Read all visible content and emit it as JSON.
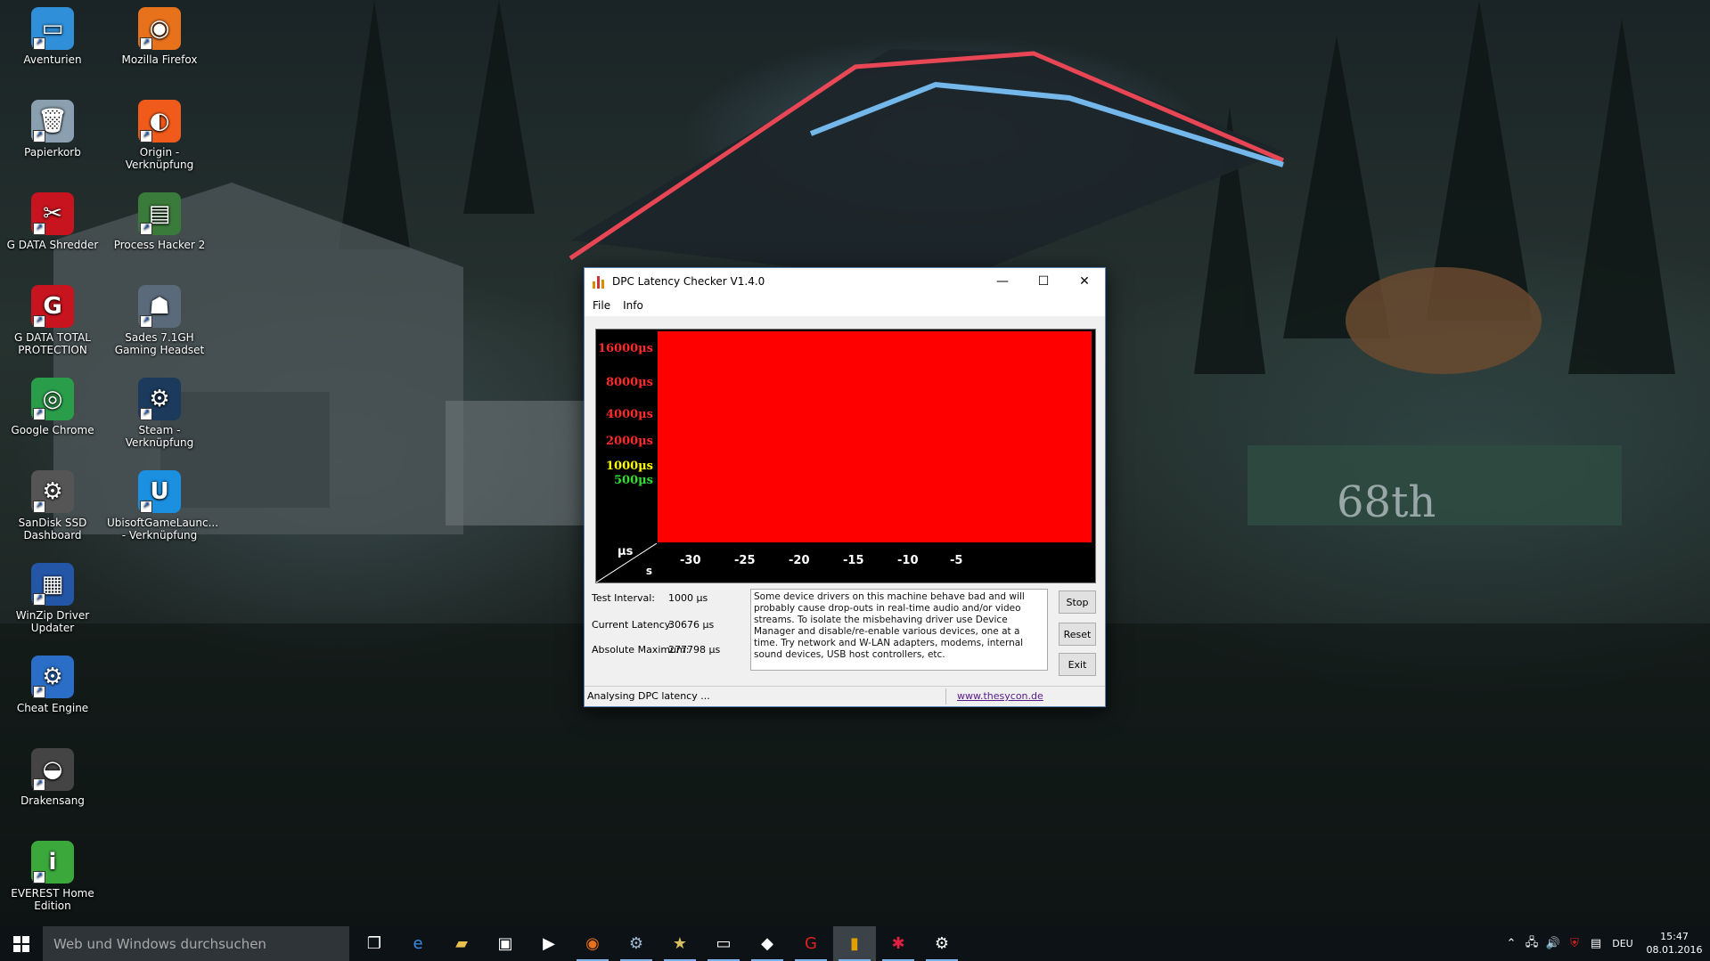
{
  "desktop": {
    "icons": [
      {
        "label": "Aventurien",
        "glyph": "▭",
        "color": "#2f8fd8"
      },
      {
        "label": "Mozilla Firefox",
        "glyph": "◉",
        "color": "#e8721c"
      },
      {
        "label": "Papierkorb",
        "glyph": "🗑",
        "color": "#8aa0b0"
      },
      {
        "label": "Origin - Verknüpfung",
        "glyph": "◐",
        "color": "#f05a1a"
      },
      {
        "label": "G DATA Shredder",
        "glyph": "✂",
        "color": "#c8141e"
      },
      {
        "label": "Process Hacker 2",
        "glyph": "▤",
        "color": "#3a7a3a"
      },
      {
        "label": "G DATA TOTAL PROTECTION",
        "glyph": "G",
        "color": "#c8141e"
      },
      {
        "label": "Sades 7.1GH Gaming Headset",
        "glyph": "☗",
        "color": "#5a6a7a"
      },
      {
        "label": "Google Chrome",
        "glyph": "◎",
        "color": "#2a9d4a"
      },
      {
        "label": "Steam - Verknüpfung",
        "glyph": "⚙",
        "color": "#1b3a5c"
      },
      {
        "label": "SanDisk SSD Dashboard",
        "glyph": "⚙",
        "color": "#555555"
      },
      {
        "label": "UbisoftGameLaunc... - Verknüpfung",
        "glyph": "U",
        "color": "#1b8fe0"
      },
      {
        "label": "WinZip Driver Updater",
        "glyph": "▦",
        "color": "#2456a8"
      },
      {
        "label": "Cheat Engine",
        "glyph": "⚙",
        "color": "#2a6ec8"
      },
      {
        "label": "Drakensang",
        "glyph": "◒",
        "color": "#444444"
      },
      {
        "label": "EVEREST Home Edition",
        "glyph": "i",
        "color": "#3aa83a"
      }
    ]
  },
  "window": {
    "title": "DPC Latency Checker V1.4.0",
    "menu": [
      "File",
      "Info"
    ],
    "controls": {
      "minimize": "—",
      "maximize": "☐",
      "close": "✕"
    }
  },
  "chart_data": {
    "type": "bar",
    "title": "",
    "xlabel": "s",
    "ylabel": "µs",
    "x_ticks": [
      "-30",
      "-25",
      "-20",
      "-15",
      "-10",
      "-5"
    ],
    "y_ticks": [
      {
        "label": "16000µs",
        "color": "#ff2a2a"
      },
      {
        "label": "8000µs",
        "color": "#ff2a2a"
      },
      {
        "label": "4000µs",
        "color": "#ff2a2a"
      },
      {
        "label": "2000µs",
        "color": "#ff2a2a"
      },
      {
        "label": "1000µs",
        "color": "#ffff00"
      },
      {
        "label": "500µs",
        "color": "#33dd33"
      }
    ],
    "bar_count": 35,
    "bar_value": "above 16000µs",
    "bar_color": "#ff0000"
  },
  "stats": {
    "test_interval_label": "Test Interval:",
    "test_interval_value": "1000 µs",
    "current_latency_label": "Current Latency:",
    "current_latency_value": "30676 µs",
    "absolute_max_label": "Absolute Maximum:",
    "absolute_max_value": "277798 µs"
  },
  "message": "Some device drivers on this machine behave bad and will probably cause drop-outs in real-time audio and/or video streams. To isolate the misbehaving driver use Device Manager and disable/re-enable various devices, one at a time. Try network and W-LAN adapters, modems, internal sound devices, USB host controllers, etc.",
  "buttons": {
    "stop": "Stop",
    "reset": "Reset",
    "exit": "Exit"
  },
  "status": {
    "text": "Analysing DPC latency ...",
    "link": "www.thesycon.de"
  },
  "taskbar": {
    "search_placeholder": "Web und Windows durchsuchen",
    "apps": [
      {
        "name": "task-view",
        "glyph": "❐"
      },
      {
        "name": "edge",
        "glyph": "e"
      },
      {
        "name": "file-explorer",
        "glyph": "▰"
      },
      {
        "name": "store",
        "glyph": "▣"
      },
      {
        "name": "media-player",
        "glyph": "▶"
      },
      {
        "name": "firefox",
        "glyph": "◉"
      },
      {
        "name": "steam",
        "glyph": "⚙"
      },
      {
        "name": "star-app",
        "glyph": "★"
      },
      {
        "name": "monitor-app",
        "glyph": "▭"
      },
      {
        "name": "network-app",
        "glyph": "◆"
      },
      {
        "name": "gdata",
        "glyph": "G"
      },
      {
        "name": "dpc-latency",
        "glyph": "▮"
      },
      {
        "name": "cluster-app",
        "glyph": "✱"
      },
      {
        "name": "ssd-dashboard",
        "glyph": "⚙"
      }
    ],
    "language": "DEU",
    "time": "15:47",
    "date": "08.01.2016"
  }
}
